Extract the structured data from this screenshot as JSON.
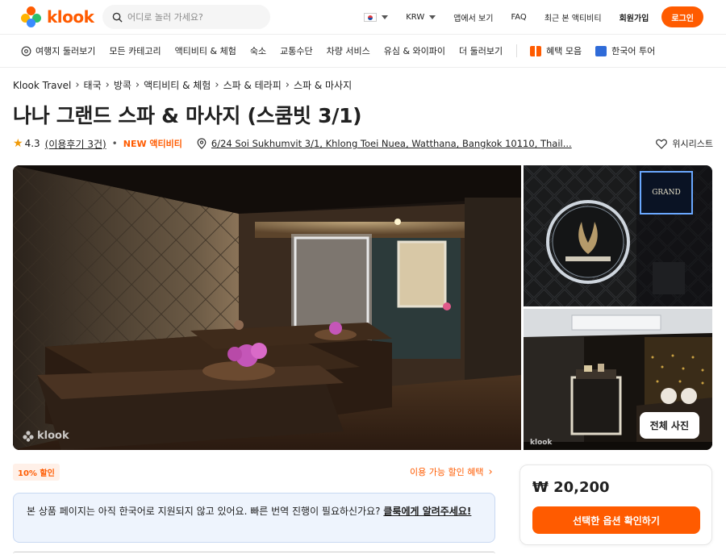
{
  "brand": {
    "name": "klook",
    "accent": "#ff5b00"
  },
  "search": {
    "placeholder": "어디로 놀러 가세요?"
  },
  "topnav": {
    "currency": "KRW",
    "app": "앱에서 보기",
    "faq": "FAQ",
    "recent": "최근 본 액티비티",
    "signup": "회원가입",
    "login": "로그인"
  },
  "catnav": [
    "여행지 둘러보기",
    "모든 카테고리",
    "액티비티 & 체험",
    "숙소",
    "교통수단",
    "차량 서비스",
    "유심 & 와이파이",
    "더 둘러보기"
  ],
  "catnav_extra": {
    "benefits": "혜택 모음",
    "korean_tour": "한국어 투어"
  },
  "breadcrumb": [
    "Klook Travel",
    "태국",
    "방콕",
    "액티비티 & 체험",
    "스파 & 테라피",
    "스파 & 마사지"
  ],
  "title": "나나 그랜드 스파 & 마사지 (스쿰빗 3/1)",
  "meta": {
    "rating": "4.3",
    "reviews": "(이용후기 3건)",
    "new_tag": "NEW 액티비티",
    "address": "6/24 Soi Sukhumvit 3/1, Khlong Toei Nuea, Watthana, Bangkok 10110, Thail...",
    "wishlist": "위시리스트"
  },
  "gallery": {
    "watermark": "klook",
    "all_photos": "전체 사진",
    "sign_text": "GRAND"
  },
  "discount": {
    "tag": "10% 할인",
    "benefits_link": "이용 가능 할인 혜택"
  },
  "notice": {
    "text": "본 상품 페이지는 아직 한국어로 지원되지 않고 있어요. 빠른 번역 진행이 필요하신가요? ",
    "link": "클룩에게 알려주세요!"
  },
  "booking": {
    "price": "₩ 20,200",
    "cta": "선택한 옵션 확인하기"
  }
}
